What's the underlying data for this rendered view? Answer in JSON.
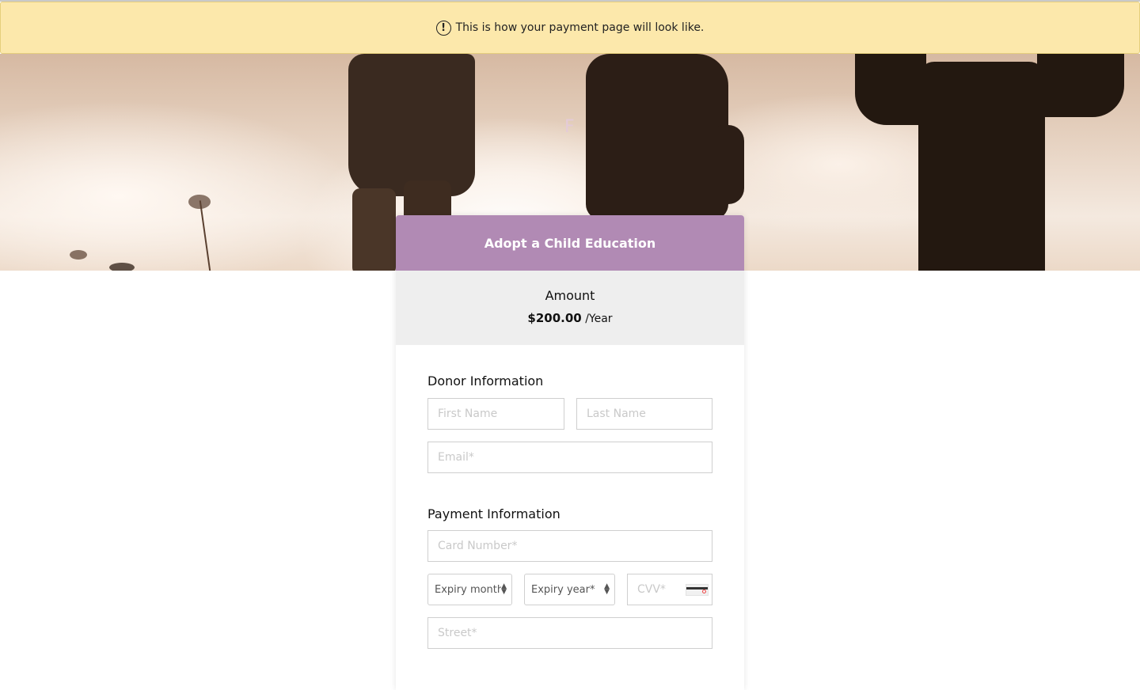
{
  "notice": {
    "icon": "exclamation-circle-icon",
    "text": "This is how your payment page will look like."
  },
  "banner": {
    "overlay_letter": "F"
  },
  "card": {
    "title": "Adopt a Child Education",
    "header_color": "#b18ab4",
    "amount_label": "Amount",
    "amount_value": "$200.00",
    "amount_period": "/Year"
  },
  "donor": {
    "title": "Donor Information",
    "first_name_placeholder": "First Name",
    "last_name_placeholder": "Last Name",
    "email_placeholder": "Email*"
  },
  "payment": {
    "title": "Payment Information",
    "card_number_placeholder": "Card Number*",
    "expiry_month": "Expiry month",
    "expiry_year": "Expiry year*",
    "cvv_placeholder": "CVV*",
    "cvv_icon": "card-cvv-icon",
    "street_placeholder": "Street*"
  }
}
